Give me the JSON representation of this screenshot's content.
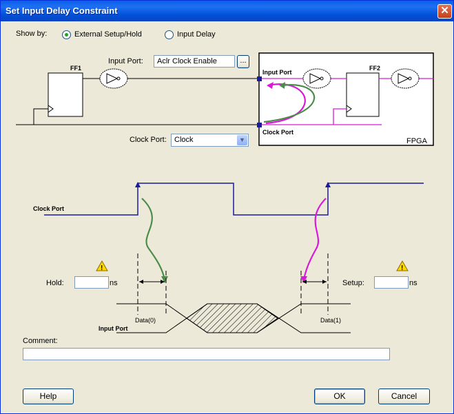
{
  "title": "Set Input Delay Constraint",
  "show_by": {
    "label": "Show by:",
    "options": [
      "External Setup/Hold",
      "Input Delay"
    ],
    "selected": "External Setup/Hold"
  },
  "input_port": {
    "label": "Input Port:",
    "value": "Aclr Clock Enable",
    "browse_label": "..."
  },
  "clock_port": {
    "label": "Clock Port:",
    "value": "Clock"
  },
  "schematic": {
    "ff1": "FF1",
    "ff2": "FF2",
    "fpga": "FPGA",
    "input_port_pin": "Input Port",
    "clock_port_pin": "Clock Port"
  },
  "waveform": {
    "clock_port_label": "Clock Port",
    "input_port_label": "Input Port",
    "data0": "Data(0)",
    "data1": "Data(1)"
  },
  "hold": {
    "label": "Hold:",
    "value": "",
    "unit": "ns"
  },
  "setup": {
    "label": "Setup:",
    "value": "",
    "unit": "ns"
  },
  "comment": {
    "label": "Comment:",
    "value": ""
  },
  "buttons": {
    "help": "Help",
    "ok": "OK",
    "cancel": "Cancel"
  },
  "colors": {
    "hold_arrow": "#4a8c4a",
    "setup_arrow": "#d81ad8",
    "clock_wave": "#1a1aa0"
  }
}
